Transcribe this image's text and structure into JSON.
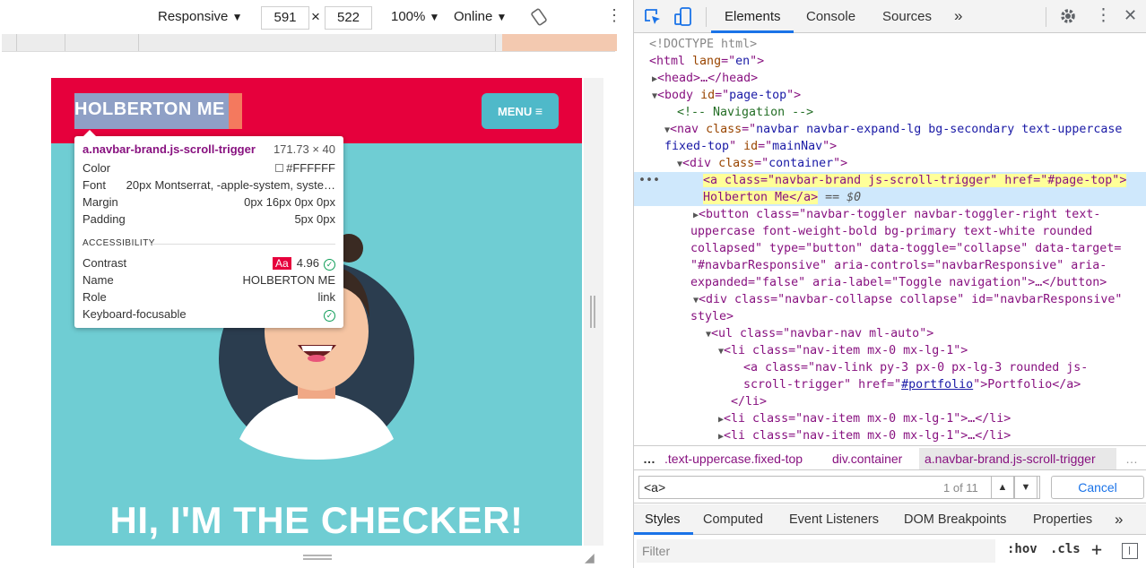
{
  "device_toolbar": {
    "device": "Responsive",
    "width": "591",
    "times": "×",
    "height": "522",
    "zoom": "100%",
    "throttle": "Online"
  },
  "site": {
    "brand": "HOLBERTON ME",
    "menu_label": "MENU",
    "hero_title": "HI, I'M THE CHECKER!"
  },
  "tooltip": {
    "selector": "a.navbar-brand.js-scroll-trigger",
    "size": "171.73 × 40",
    "rows": [
      {
        "label": "Color",
        "value": "#FFFFFF"
      },
      {
        "label": "Font",
        "value": "20px Montserrat, -apple-system, syste…"
      },
      {
        "label": "Margin",
        "value": "0px 16px 0px 0px"
      },
      {
        "label": "Padding",
        "value": "5px 0px"
      }
    ],
    "accessibility_heading": "ACCESSIBILITY",
    "a11y": {
      "contrast_label": "Contrast",
      "contrast_badge": "Aa",
      "contrast_value": "4.96",
      "name_label": "Name",
      "name_value": "HOLBERTON ME",
      "role_label": "Role",
      "role_value": "link",
      "keyboard_label": "Keyboard-focusable"
    }
  },
  "devtools": {
    "tabs": [
      "Elements",
      "Console",
      "Sources"
    ],
    "more_tabs": "»",
    "breadcrumb": [
      "…",
      ".text-uppercase.fixed-top",
      "div.container",
      "a.navbar-brand.js-scroll-trigger",
      "…"
    ],
    "search": {
      "value": "<a>",
      "count": "1 of 11",
      "cancel": "Cancel"
    },
    "styles_tabs": [
      "Styles",
      "Computed",
      "Event Listeners",
      "DOM Breakpoints",
      "Properties"
    ],
    "styles_more": "»",
    "filter_placeholder": "Filter",
    "hov": ":hov",
    "cls": ".cls",
    "plus": "+",
    "selected_marker": "•••",
    "dollar": "== $0"
  },
  "dom": {
    "doctype": "<!DOCTYPE html>",
    "comment": "<!-- Navigation -->",
    "html_open": [
      "<html ",
      "lang",
      "=\"",
      "en",
      "\">"
    ],
    "head": "<head>…</head>",
    "body": [
      "<body ",
      "id",
      "=\"",
      "page-top",
      "\">"
    ],
    "nav_1": [
      "<nav ",
      "class",
      "=\"",
      "navbar navbar-expand-lg bg-secondary text-uppercase"
    ],
    "nav_2": [
      "fixed-top",
      "\" ",
      "id",
      "=\"",
      "mainNav",
      "\">"
    ],
    "container": [
      "<div ",
      "class",
      "=\"",
      "container",
      "\">"
    ],
    "sel_1": "<a class=\"navbar-brand js-scroll-trigger\" href=\"#page-top\">",
    "sel_2": "Holberton Me</a>",
    "button_1": "<button class=\"navbar-toggler navbar-toggler-right text-",
    "button_2": "uppercase font-weight-bold bg-primary text-white rounded",
    "button_3": "collapsed\" type=\"button\" data-toggle=\"collapse\" data-target=",
    "button_4": "\"#navbarResponsive\" aria-controls=\"navbarResponsive\" aria-",
    "button_5": "expanded=\"false\" aria-label=\"Toggle navigation\">…</button>",
    "collapse_1": "<div class=\"navbar-collapse collapse\" id=\"navbarResponsive\"",
    "collapse_2": "style>",
    "ul": "<ul class=\"navbar-nav ml-auto\">",
    "li_1": "<li class=\"nav-item mx-0 mx-lg-1\">",
    "a_1": "<a class=\"nav-link py-3 px-0 px-lg-3 rounded js-",
    "a_2a": "scroll-trigger\" href=\"",
    "a_2link": "#portfolio",
    "a_2b": "\">Portfolio</a>",
    "li_close": "</li>",
    "li_2": "<li class=\"nav-item mx-0 mx-lg-1\">…</li>",
    "li_3": "<li class=\"nav-item mx-0 mx-lg-1\">…</li>"
  },
  "colors": {
    "nav_red": "#e6003c",
    "hero_teal": "#6fcdd3",
    "menu_teal": "#4fb9c9",
    "avatar_dark": "#2b3d4f",
    "tab_blue": "#1a73e8"
  }
}
